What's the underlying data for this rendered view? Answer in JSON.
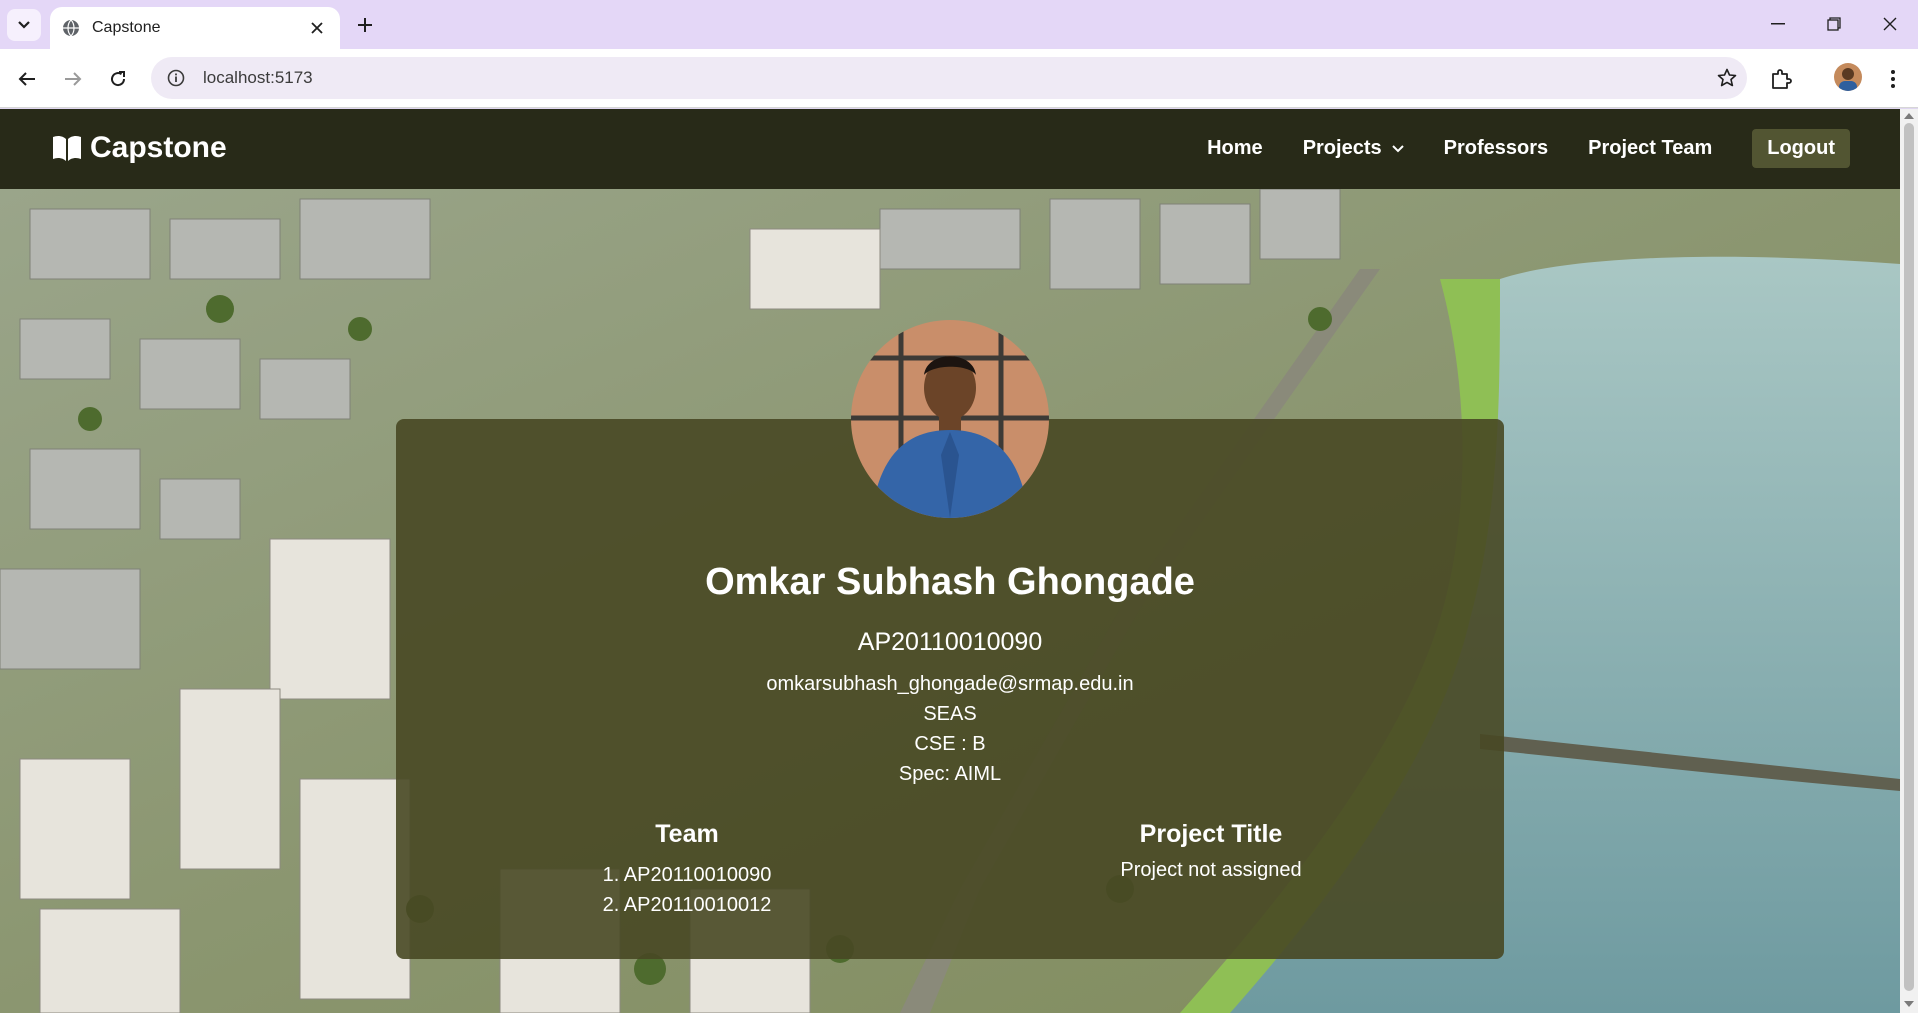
{
  "browser": {
    "tab_title": "Capstone",
    "url": "localhost:5173"
  },
  "navbar": {
    "brand": "Capstone",
    "links": [
      "Home",
      "Projects",
      "Professors",
      "Project Team"
    ],
    "logout": "Logout"
  },
  "profile": {
    "name": "Omkar Subhash Ghongade",
    "id": "AP20110010090",
    "email": "omkarsubhash_ghongade@srmap.edu.in",
    "school": "SEAS",
    "branch": "CSE : B",
    "spec": "Spec: AIML"
  },
  "team": {
    "heading": "Team",
    "members": [
      "1. AP20110010090",
      "2. AP20110010012"
    ]
  },
  "project": {
    "heading": "Project Title",
    "value": "Project not assigned"
  },
  "colors": {
    "navbar": "#282a18",
    "card": "#484824",
    "logout": "#525532",
    "tabstrip": "#e4d7f7"
  }
}
